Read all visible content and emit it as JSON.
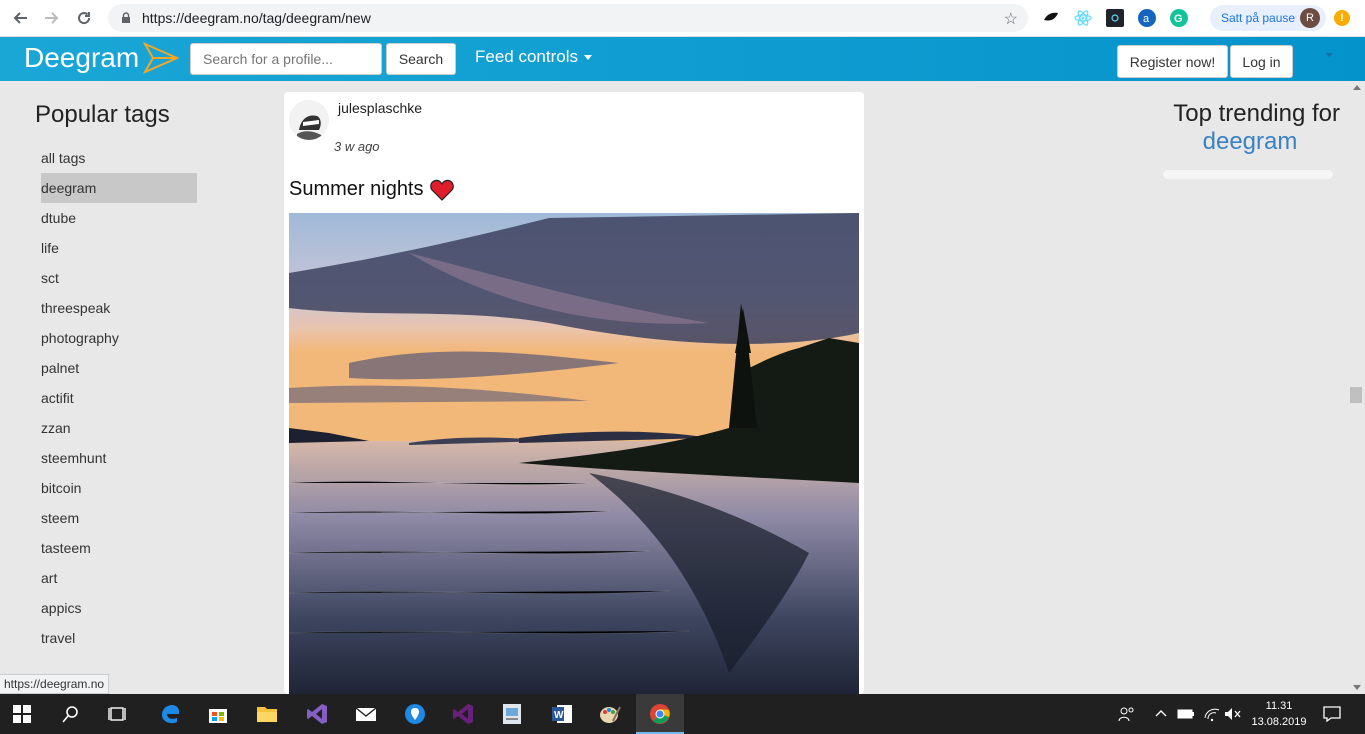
{
  "browser": {
    "url": "https://deegram.no/tag/deegram/new",
    "profile_label": "Satt på pause",
    "profile_initial": "R",
    "alert_glyph": "!"
  },
  "navbar": {
    "brand": "Deegram",
    "search_placeholder": "Search for a profile...",
    "search_button": "Search",
    "feed_controls": "Feed controls",
    "register_button": "Register now!",
    "login_button": "Log in"
  },
  "sidebar": {
    "title": "Popular tags",
    "tags": [
      {
        "label": "all tags"
      },
      {
        "label": "deegram",
        "active": true
      },
      {
        "label": "dtube"
      },
      {
        "label": "life"
      },
      {
        "label": "sct"
      },
      {
        "label": "threespeak"
      },
      {
        "label": "photography"
      },
      {
        "label": "palnet"
      },
      {
        "label": "actifit"
      },
      {
        "label": "zzan"
      },
      {
        "label": "steemhunt"
      },
      {
        "label": "bitcoin"
      },
      {
        "label": "steem"
      },
      {
        "label": "tasteem"
      },
      {
        "label": "art"
      },
      {
        "label": "appics"
      },
      {
        "label": "travel"
      }
    ]
  },
  "post": {
    "username": "julesplaschke",
    "time_ago": "3 w ago",
    "title": "Summer nights"
  },
  "trending": {
    "title": "Top trending for",
    "tag": "deegram"
  },
  "status_url": "https://deegram.no",
  "taskbar": {
    "time": "11.31",
    "date": "13.08.2019"
  },
  "colors": {
    "navbar": "#0593cc",
    "trending_tag": "#3a82c4",
    "active_tag_bg": "#c8c8c8"
  }
}
